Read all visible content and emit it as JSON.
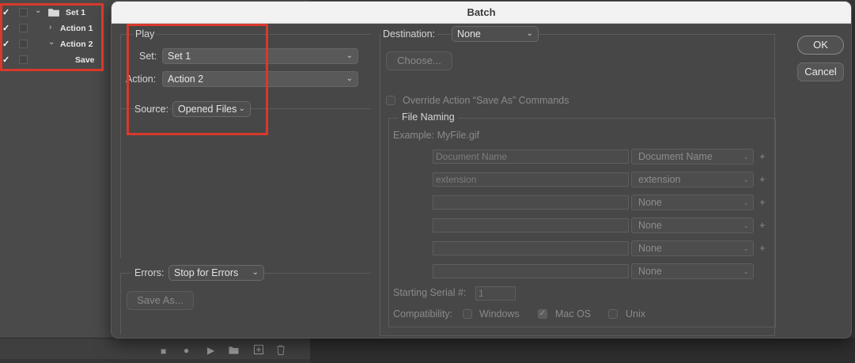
{
  "actions_panel": {
    "rows": [
      {
        "label": "Set 1",
        "checked": true,
        "expanded": true,
        "is_set": true
      },
      {
        "label": "Action 1",
        "checked": true,
        "expanded": false
      },
      {
        "label": "Action 2",
        "checked": true,
        "expanded": true
      },
      {
        "label": "Save",
        "checked": true
      }
    ],
    "toolbar_icons": [
      "stop-icon",
      "record-icon",
      "play-icon",
      "folder-icon",
      "new-action-icon",
      "trash-icon"
    ]
  },
  "dialog": {
    "title": "Batch",
    "ok_label": "OK",
    "cancel_label": "Cancel",
    "play": {
      "legend": "Play",
      "set_label": "Set:",
      "set_value": "Set 1",
      "action_label": "Action:",
      "action_value": "Action 2",
      "source_label": "Source:",
      "source_value": "Opened Files"
    },
    "errors": {
      "label": "Errors:",
      "value": "Stop for Errors",
      "save_as_label": "Save As..."
    },
    "destination": {
      "label": "Destination:",
      "value": "None",
      "choose_label": "Choose...",
      "override_label": "Override Action “Save As” Commands"
    },
    "file_naming": {
      "legend": "File Naming",
      "example": "Example: MyFile.gif",
      "rows": [
        {
          "field": "Document Name",
          "select": "Document Name",
          "plus": true
        },
        {
          "field": "extension",
          "select": "extension",
          "plus": true
        },
        {
          "field": "",
          "select": "None",
          "plus": true
        },
        {
          "field": "",
          "select": "None",
          "plus": true
        },
        {
          "field": "",
          "select": "None",
          "plus": true
        },
        {
          "field": "",
          "select": "None",
          "plus": false
        }
      ],
      "serial_label": "Starting Serial #:",
      "serial_value": "1",
      "compat_label": "Compatibility:",
      "windows_label": "Windows",
      "macos_label": "Mac OS",
      "unix_label": "Unix",
      "windows_checked": false,
      "macos_checked": true,
      "unix_checked": false
    }
  },
  "colors": {
    "highlight": "#d8392b",
    "dialog_bg": "#474747",
    "titlebar_bg": "#f2f2f2"
  }
}
